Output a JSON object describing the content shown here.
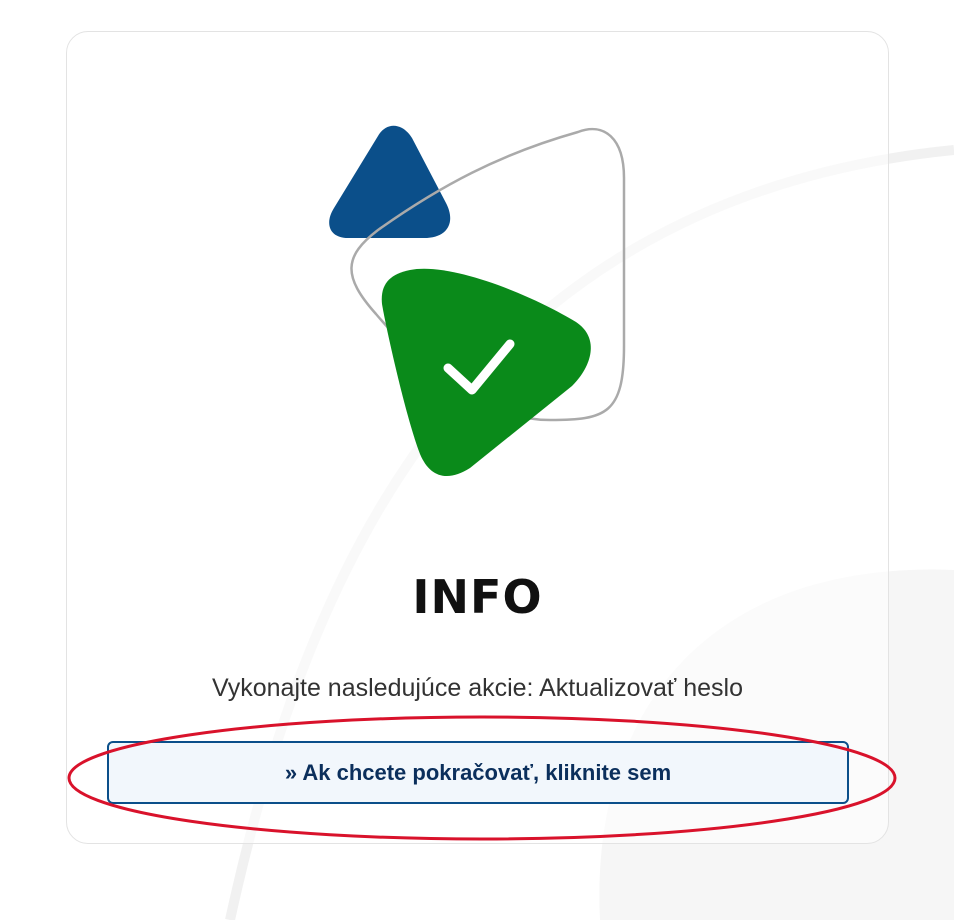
{
  "info": {
    "title": "INFO",
    "message": "Vykonajte nasledujúce akcie: Aktualizovať heslo",
    "continue_link": "» Ak chcete pokračovať, kliknite sem"
  },
  "icons": {
    "illustration": "success-check-icon",
    "check": "checkmark-icon"
  },
  "colors": {
    "brand_blue": "#0b4f8a",
    "success_green": "#0a8a1a",
    "outline_gray": "#aaaaaa",
    "annotation_red": "#d9122b",
    "link_text": "#0b2f5c"
  }
}
